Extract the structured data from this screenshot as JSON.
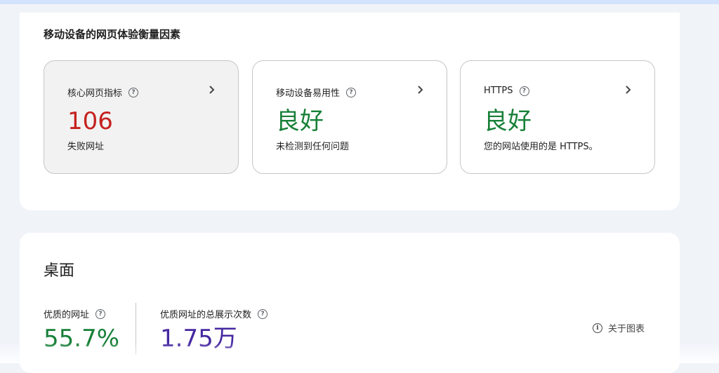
{
  "mobile_section": {
    "title": "移动设备的网页体验衡量因素",
    "cards": [
      {
        "label": "核心网页指标",
        "value": "106",
        "sub": "失败网址",
        "help": "?",
        "status_color": "#c5221f"
      },
      {
        "label": "移动设备易用性",
        "value": "良好",
        "sub": "未检测到任何问题",
        "help": "?",
        "status_color": "#188038"
      },
      {
        "label": "HTTPS",
        "value": "良好",
        "sub": "您的网站使用的是 HTTPS。",
        "help": "?",
        "status_color": "#188038"
      }
    ]
  },
  "desktop_section": {
    "title": "桌面",
    "metrics": [
      {
        "label": "优质的网址",
        "value": "55.7%",
        "help": "?"
      },
      {
        "label": "优质网址的总展示次数",
        "value": "1.75万",
        "help": "?"
      }
    ],
    "about_chart": {
      "label": "关于图表",
      "icon": "i"
    }
  },
  "icons": {
    "help": "help-circle-icon",
    "chevron": "chevron-right-icon",
    "info": "info-icon"
  },
  "colors": {
    "fail": "#c5221f",
    "good": "#188038",
    "impressions": "#4527a0"
  }
}
